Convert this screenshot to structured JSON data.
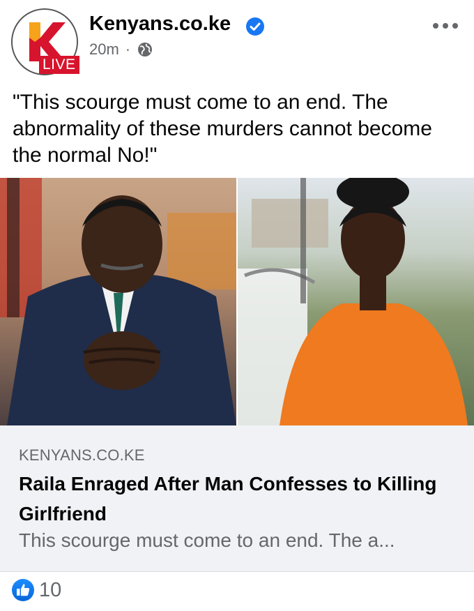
{
  "post": {
    "page_name": "Kenyans.co.ke",
    "live_badge": "LIVE",
    "time": "20m",
    "separator": "·",
    "privacy_icon": "globe-icon",
    "verified_icon": "verified-badge-icon",
    "more_icon": "more-options-icon",
    "text": "\"This scourge must come to an end. The abnormality of these murders cannot become the normal No!\""
  },
  "link": {
    "domain": "KENYANS.CO.KE",
    "title": "Raila Enraged After Man Confesses to Killing Girlfriend",
    "description": "This scourge must come to an end. The a..."
  },
  "reactions": {
    "icon": "like-icon",
    "count": "10"
  },
  "colors": {
    "brand_red": "#d7142d",
    "verified_blue": "#1877f2",
    "secondary_text": "#65676b",
    "card_bg": "#f0f2f5"
  }
}
